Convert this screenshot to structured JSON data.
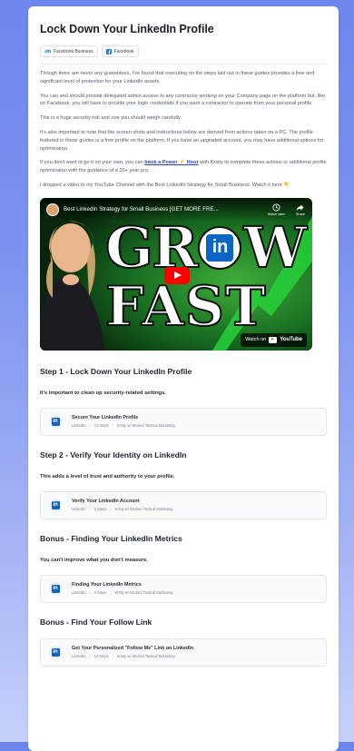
{
  "title": "Lock Down Your LinkedIn Profile",
  "badges": [
    {
      "label": "Facebook Business",
      "icon": "meta-icon"
    },
    {
      "label": "Facebook",
      "icon": "facebook-icon"
    }
  ],
  "paragraphs": {
    "p1": "Though there are never any guarantees, I've found that executing on the steps laid out in these guides provides a free and significant level of protection for your LinkedIn assets.",
    "p2": "You can and should provide delegated admin access to any contractor working on your Company page on the platform but, like on Facebook, you will have to provide your login credentials if you want a contractor to operate from your personal profile.",
    "p3": "This is a huge security risk and one you should weigh carefully.",
    "p4": "It's also important to note that the screen shots and instructions below are derived from actions taken on a PC. The profile featured in these guides is a free profile on the platform. If you have an upgraded account, you may have additional options for optimization.",
    "p5_before": "If you don't want to go it on your own, you can ",
    "p5_link": "book a Power ⚡ Hour",
    "p5_after": " with Kristy to complete these actions or additional profile optimization with the guidance of a 20+ year pro.",
    "p6": "I dropped a video to my YouTube Channel with the Best LinkedIn Strategy for Small Business. Watch it here 👇"
  },
  "video": {
    "title": "Best LinkedIn Strategy for Small Business [GET MORE FRE...",
    "thumb_top": "GR",
    "thumb_in": "in",
    "thumb_w": "W",
    "thumb_bottom": "FAST",
    "watch_later": "Watch later",
    "share": "Share",
    "watch_on": "Watch on",
    "youtube": "YouTube"
  },
  "sections": [
    {
      "heading": "Step 1 - Lock Down Your LinkedIn Profile",
      "sub": "It's important to clean up security-related settings.",
      "link": {
        "title": "Secure Your LinkedIn Profile",
        "tag": "LinkedIn",
        "steps": "14 Steps",
        "author": "Kristy w/ Wicked Tactical Marketing"
      }
    },
    {
      "heading": "Step 2 - Verify Your Identity on LinkedIn",
      "sub": "This adds a level of trust and authority to your profile.",
      "link": {
        "title": "Verify Your LinkedIn Account",
        "tag": "LinkedIn",
        "steps": "5 Steps",
        "author": "Kristy w/ Wicked Tactical Marketing"
      }
    },
    {
      "heading": "Bonus - Finding Your LinkedIn Metrics",
      "sub": "You can't improve what you don't measure.",
      "link": {
        "title": "Finding Your LinkedIn Metrics",
        "tag": "LinkedIn",
        "steps": "4 Steps",
        "author": "Kristy w/ Wicked Tactical Marketing"
      }
    },
    {
      "heading": "Bonus - Find Your Follow Link",
      "sub": "",
      "link": {
        "title": "Get Your Personalized \"Follow Me\" Link on LinkedIn",
        "tag": "LinkedIn",
        "steps": "12 Steps",
        "author": "Kristy w/ Wicked Tactical Marketing"
      }
    }
  ],
  "colors": {
    "background": "#7d93f0",
    "linkedin": "#0a66c2",
    "youtube_red": "#ff0000",
    "link_blue": "#2d47c8"
  }
}
